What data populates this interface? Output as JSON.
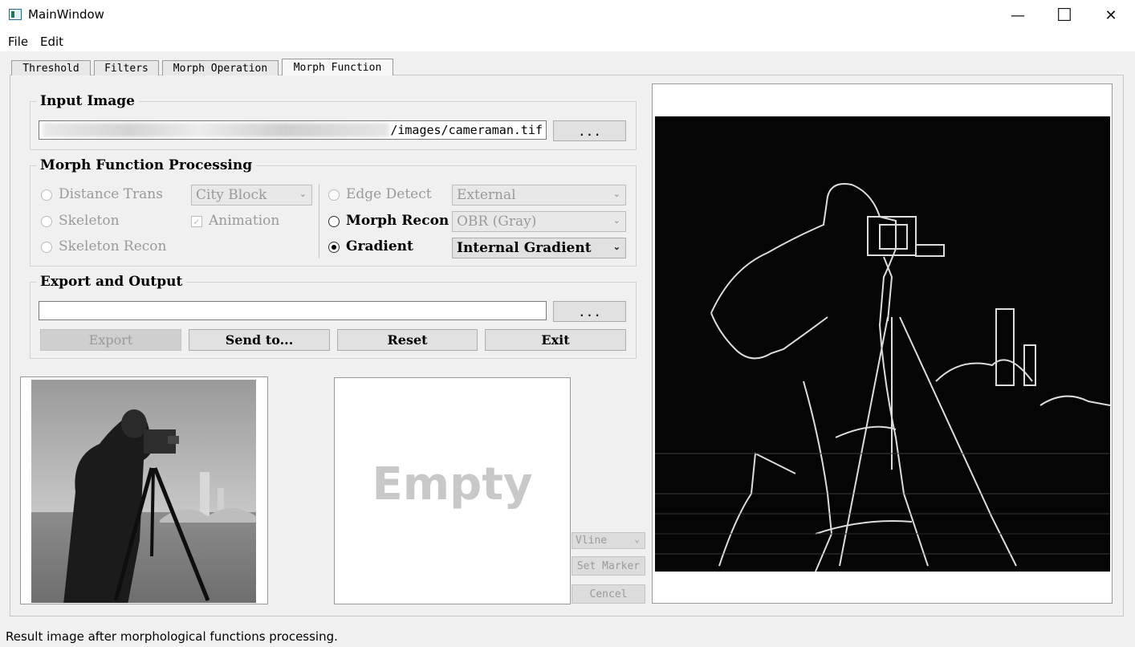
{
  "window": {
    "title": "MainWindow",
    "minimize": "—",
    "maximize": "☐",
    "close": "✕"
  },
  "menu": [
    "File",
    "Edit"
  ],
  "tabs": [
    "Threshold",
    "Filters",
    "Morph Operation",
    "Morph Function"
  ],
  "active_tab": "Morph Function",
  "input_image": {
    "title": "Input Image",
    "path_value": "/images/cameraman.tif",
    "browse_label": "..."
  },
  "processing": {
    "title": "Morph Function Processing",
    "distance_trans": {
      "label": "Distance Trans",
      "combo": "City Block"
    },
    "skeleton": {
      "label": "Skeleton"
    },
    "animation": {
      "label": "Animation",
      "checked": true
    },
    "skeleton_recon": {
      "label": "Skeleton Recon"
    },
    "edge_detect": {
      "label": "Edge Detect",
      "combo": "External"
    },
    "morph_recon": {
      "label": "Morph Recon",
      "combo": "OBR (Gray)"
    },
    "gradient": {
      "label": "Gradient",
      "combo": "Internal Gradient",
      "selected": true
    }
  },
  "export": {
    "title": "Export and Output",
    "path_value": "",
    "browse_label": "...",
    "export_label": "Export",
    "send_label": "Send to...",
    "reset_label": "Reset",
    "exit_label": "Exit"
  },
  "marker_panel": {
    "empty_label": "Empty",
    "vline_label": "Vline",
    "set_marker_label": "Set Marker",
    "cancel_label": "Cencel"
  },
  "status": "Result image after morphological functions processing.",
  "colors": {
    "window_bg": "#f0f0f0",
    "result_bg": "#050505",
    "edge_line": "#e0e0e0",
    "disabled_text": "#9a9a9a"
  }
}
